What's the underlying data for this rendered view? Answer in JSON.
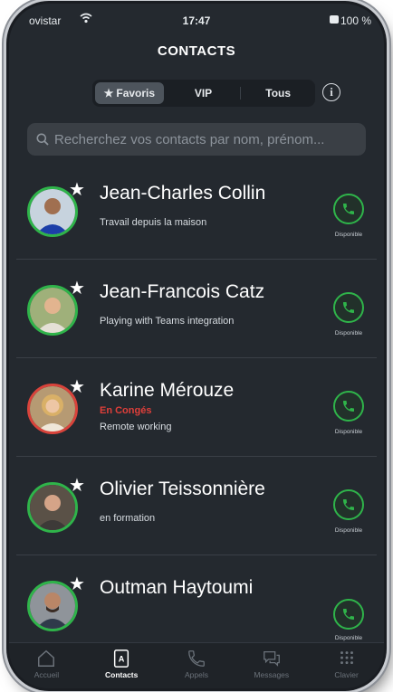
{
  "status_bar": {
    "carrier": "ovistar",
    "time": "17:47",
    "battery": "100 %"
  },
  "header": {
    "title": "CONTACTS"
  },
  "segments": [
    {
      "label": "Favoris",
      "icon": "star-icon",
      "active": true
    },
    {
      "label": "VIP",
      "active": false
    },
    {
      "label": "Tous",
      "active": false
    }
  ],
  "search": {
    "placeholder": "Recherchez vos contacts par nom, prénom..."
  },
  "contacts": [
    {
      "name": "Jean-Charles Collin",
      "note": "Travail depuis  la maison",
      "absence": "",
      "presence": "available",
      "status_label": "Disponible"
    },
    {
      "name": "Jean-Francois Catz",
      "note": "Playing with Teams integration",
      "absence": "",
      "presence": "available",
      "status_label": "Disponible"
    },
    {
      "name": "Karine Mérouze",
      "note": "Remote working",
      "absence": "En Congés",
      "presence": "away",
      "status_label": "Disponible"
    },
    {
      "name": "Olivier Teissonnière",
      "note": "en formation",
      "absence": "",
      "presence": "available",
      "status_label": "Disponible"
    },
    {
      "name": "Outman Haytoumi",
      "note": "",
      "absence": "",
      "presence": "available",
      "status_label": "Disponible"
    }
  ],
  "tabbar": [
    {
      "label": "Accueil",
      "icon": "home-icon",
      "active": false
    },
    {
      "label": "Contacts",
      "icon": "contacts-icon",
      "active": true
    },
    {
      "label": "Appels",
      "icon": "phone-icon",
      "active": false
    },
    {
      "label": "Messages",
      "icon": "chat-icon",
      "active": false
    },
    {
      "label": "Clavier",
      "icon": "dialpad-icon",
      "active": false
    }
  ],
  "colors": {
    "background": "#24292f",
    "available": "#2fb44a",
    "busy": "#d9433b",
    "absence_text": "#e03f3a"
  }
}
